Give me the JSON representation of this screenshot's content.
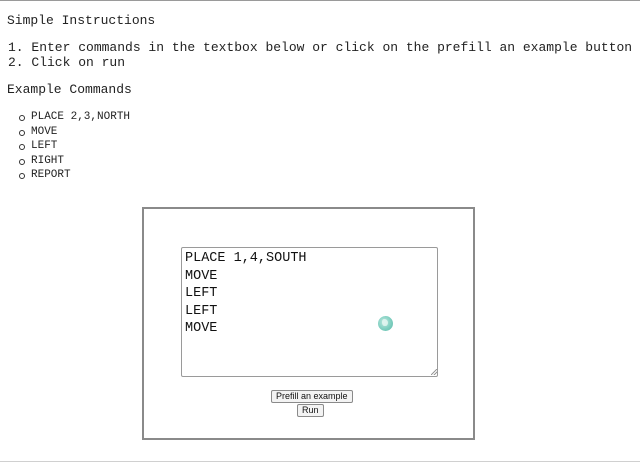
{
  "instructions": {
    "heading": "Simple Instructions",
    "steps": [
      "1. Enter commands in the textbox below or click on the prefill an example button",
      "2. Click on run"
    ]
  },
  "examples": {
    "heading": "Example Commands",
    "commands": [
      "PLACE 2,3,NORTH",
      "MOVE",
      "LEFT",
      "RIGHT",
      "REPORT"
    ]
  },
  "editor": {
    "value": "PLACE 1,4,SOUTH\nMOVE\nLEFT\nLEFT\nMOVE",
    "extension_icon": "globe-icon"
  },
  "buttons": {
    "prefill_label": "Prefill an example",
    "run_label": "Run"
  }
}
